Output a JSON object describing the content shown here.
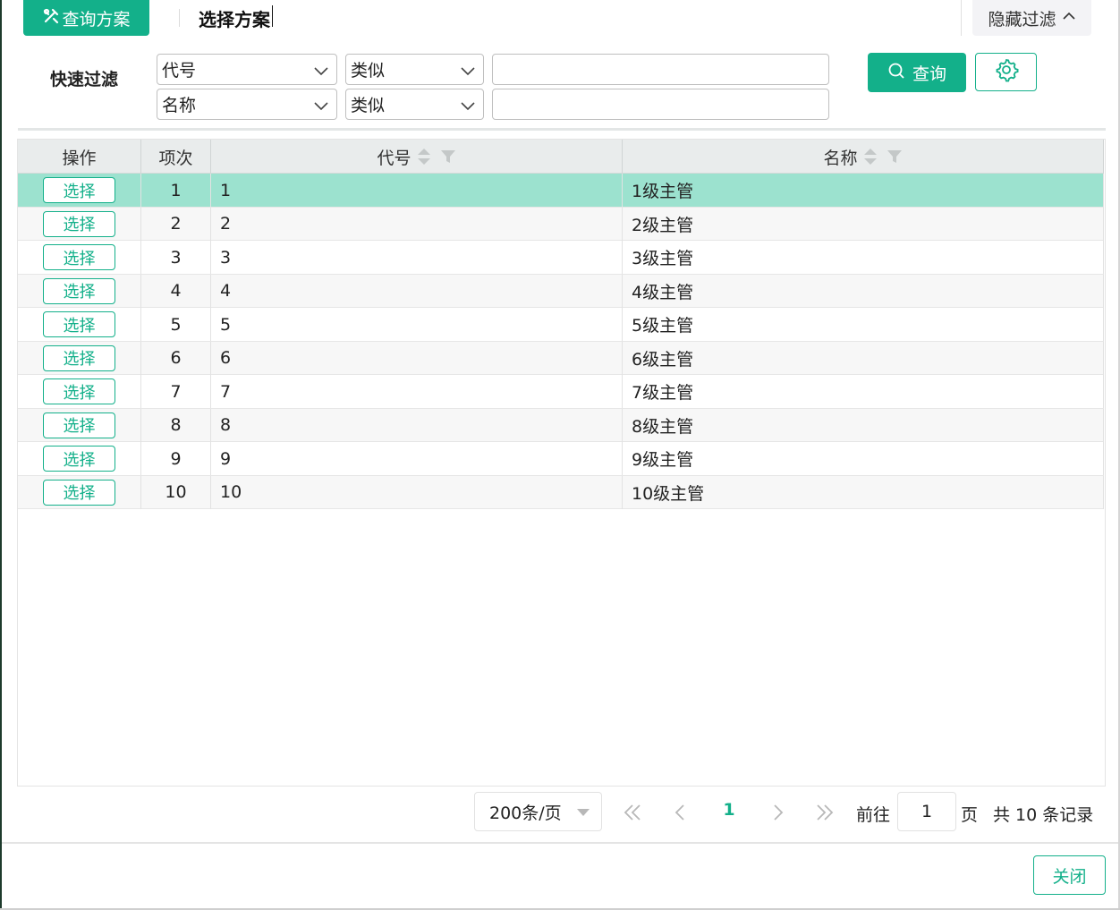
{
  "colors": {
    "accent": "#13b08a",
    "selected_row": "#9ce2cf",
    "header_bg": "#e9ecec"
  },
  "toolbar": {
    "scheme_button": "查询方案",
    "scheme_title": "选择方案",
    "hide_filter": "隐藏过滤",
    "icons": {
      "scheme": "tools-icon",
      "hide": "chevron-up-icon"
    }
  },
  "filter": {
    "label": "快速过滤",
    "rows": [
      {
        "field": "代号",
        "operator": "类似",
        "value": ""
      },
      {
        "field": "名称",
        "operator": "类似",
        "value": ""
      }
    ],
    "query_button": "查询",
    "icons": {
      "query": "search-icon",
      "settings": "gear-icon"
    }
  },
  "table": {
    "columns": [
      "操作",
      "项次",
      "代号",
      "名称"
    ],
    "rows": [
      {
        "action": "选择",
        "index": "1",
        "code": "1",
        "name": "1级主管",
        "selected": true
      },
      {
        "action": "选择",
        "index": "2",
        "code": "2",
        "name": "2级主管"
      },
      {
        "action": "选择",
        "index": "3",
        "code": "3",
        "name": "3级主管"
      },
      {
        "action": "选择",
        "index": "4",
        "code": "4",
        "name": "4级主管"
      },
      {
        "action": "选择",
        "index": "5",
        "code": "5",
        "name": "5级主管"
      },
      {
        "action": "选择",
        "index": "6",
        "code": "6",
        "name": "6级主管"
      },
      {
        "action": "选择",
        "index": "7",
        "code": "7",
        "name": "7级主管"
      },
      {
        "action": "选择",
        "index": "8",
        "code": "8",
        "name": "8级主管"
      },
      {
        "action": "选择",
        "index": "9",
        "code": "9",
        "name": "9级主管"
      },
      {
        "action": "选择",
        "index": "10",
        "code": "10",
        "name": "10级主管"
      }
    ]
  },
  "pagination": {
    "page_size": "200条/页",
    "current_page": "1",
    "goto_label": "前往",
    "goto_value": "1",
    "page_label": "页",
    "total_text": "共 10 条记录"
  },
  "footer": {
    "close_button": "关闭"
  }
}
